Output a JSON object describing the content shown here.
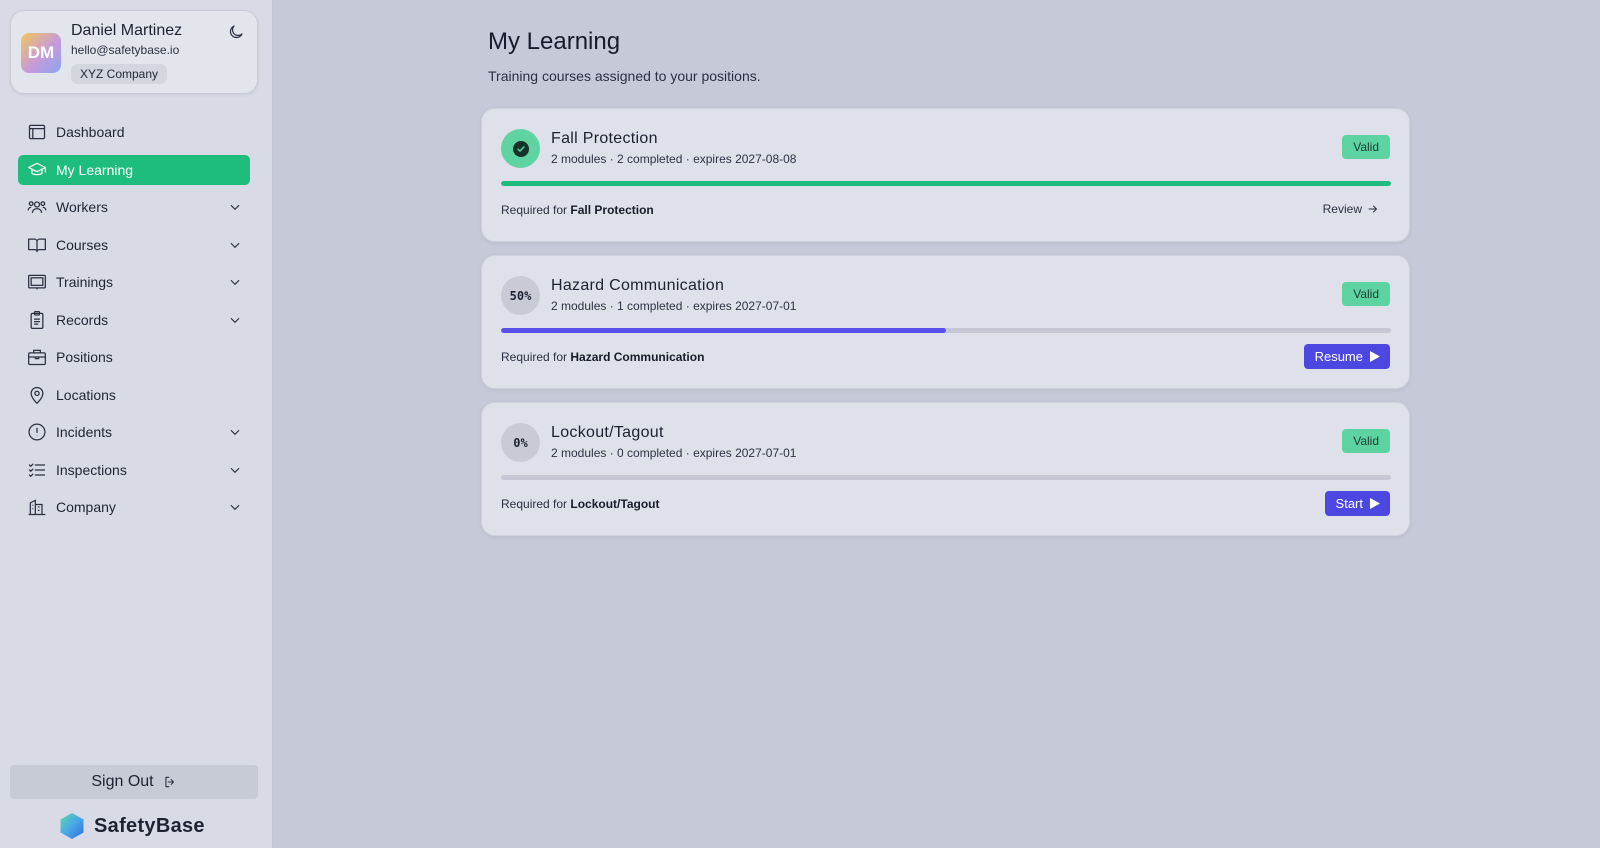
{
  "user": {
    "initials": "DM",
    "name": "Daniel Martinez",
    "email": "hello@safetybase.io",
    "company": "XYZ Company"
  },
  "theme_toggle_icon": "moon-icon",
  "nav": {
    "items": [
      {
        "label": "Dashboard",
        "icon": "dashboard-icon",
        "has_chevron": false,
        "active": false
      },
      {
        "label": "My Learning",
        "icon": "graduation-cap-icon",
        "has_chevron": false,
        "active": true
      },
      {
        "label": "Workers",
        "icon": "users-icon",
        "has_chevron": true,
        "active": false
      },
      {
        "label": "Courses",
        "icon": "book-icon",
        "has_chevron": true,
        "active": false
      },
      {
        "label": "Trainings",
        "icon": "presentation-icon",
        "has_chevron": true,
        "active": false
      },
      {
        "label": "Records",
        "icon": "clipboard-icon",
        "has_chevron": true,
        "active": false
      },
      {
        "label": "Positions",
        "icon": "briefcase-icon",
        "has_chevron": false,
        "active": false
      },
      {
        "label": "Locations",
        "icon": "map-pin-icon",
        "has_chevron": false,
        "active": false
      },
      {
        "label": "Incidents",
        "icon": "alert-circle-icon",
        "has_chevron": true,
        "active": false
      },
      {
        "label": "Inspections",
        "icon": "checklist-icon",
        "has_chevron": true,
        "active": false
      },
      {
        "label": "Company",
        "icon": "building-icon",
        "has_chevron": true,
        "active": false
      }
    ]
  },
  "signout_label": "Sign Out",
  "brand": {
    "name": "SafetyBase"
  },
  "page": {
    "title": "My Learning",
    "subtitle": "Training courses assigned to your positions."
  },
  "colors": {
    "accent_green": "#1ebd7e",
    "progress_complete": "#1ebd7e",
    "progress_partial": "#5850e8",
    "button_primary": "#4b47e0",
    "valid_badge": "#5ed3a2"
  },
  "courses": [
    {
      "title": "Fall Protection",
      "meta": "2 modules · 2 completed · expires 2027-08-08",
      "status_badge": "Valid",
      "progress_fraction": 1.0,
      "progress_label": "",
      "completed": true,
      "required_prefix": "Required for",
      "required_for": "Fall Protection",
      "action_label": "Review",
      "action_style": "link"
    },
    {
      "title": "Hazard Communication",
      "meta": "2 modules · 1 completed · expires 2027-07-01",
      "status_badge": "Valid",
      "progress_fraction": 0.5,
      "progress_label": "50%",
      "completed": false,
      "required_prefix": "Required for",
      "required_for": "Hazard Communication",
      "action_label": "Resume",
      "action_style": "button"
    },
    {
      "title": "Lockout/Tagout",
      "meta": "2 modules · 0 completed · expires 2027-07-01",
      "status_badge": "Valid",
      "progress_fraction": 0.0,
      "progress_label": "0%",
      "completed": false,
      "required_prefix": "Required for",
      "required_for": "Lockout/Tagout",
      "action_label": "Start",
      "action_style": "button"
    }
  ]
}
